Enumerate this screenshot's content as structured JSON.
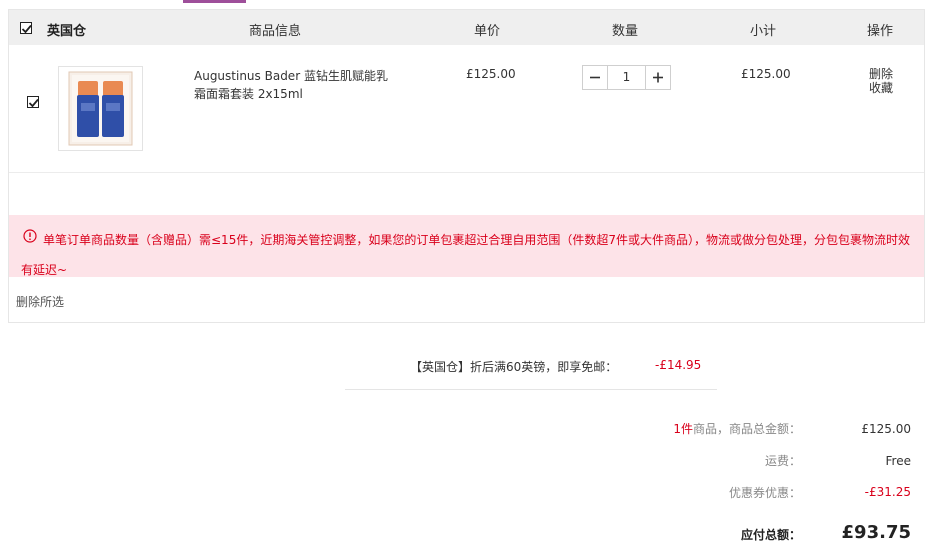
{
  "header": {
    "warehouse": "英国仓",
    "col_info": "商品信息",
    "col_price": "单价",
    "col_qty": "数量",
    "col_subtotal": "小计",
    "col_action": "操作",
    "select_all_checked": true
  },
  "item": {
    "checked": true,
    "name": "Augustinus Bader 蓝钻生肌赋能乳霜面霜套装 2x15ml",
    "price": "£125.00",
    "quantity": "1",
    "subtotal": "£125.00",
    "delete_label": "删除",
    "favorite_label": "收藏",
    "image_icon": "product-thumbnail"
  },
  "notice": {
    "text": "单笔订单商品数量（含赠品）需≤15件，近期海关管控调整，如果您的订单包裹超过合理自用范围（件数超7件或大件商品），物流或做分包处理，分包包裹物流时效有延迟~",
    "color": "#d9001b",
    "background": "#fde3e8"
  },
  "bulk": {
    "delete_selected": "删除所选"
  },
  "promo": {
    "label": "【英国仓】折后满60英镑，即享免邮：",
    "value": "-£14.95"
  },
  "summary": {
    "count_prefix": "1件",
    "count_suffix": "商品，商品总金额：",
    "goods_total": "£125.00",
    "shipping_label": "运费：",
    "shipping_value": "Free",
    "coupon_label": "优惠券优惠：",
    "coupon_value": "-£31.25",
    "total_label": "应付总额：",
    "total_value": "£93.75"
  },
  "colors": {
    "accent": "#9e4f9a",
    "discount_red": "#d9001b"
  }
}
